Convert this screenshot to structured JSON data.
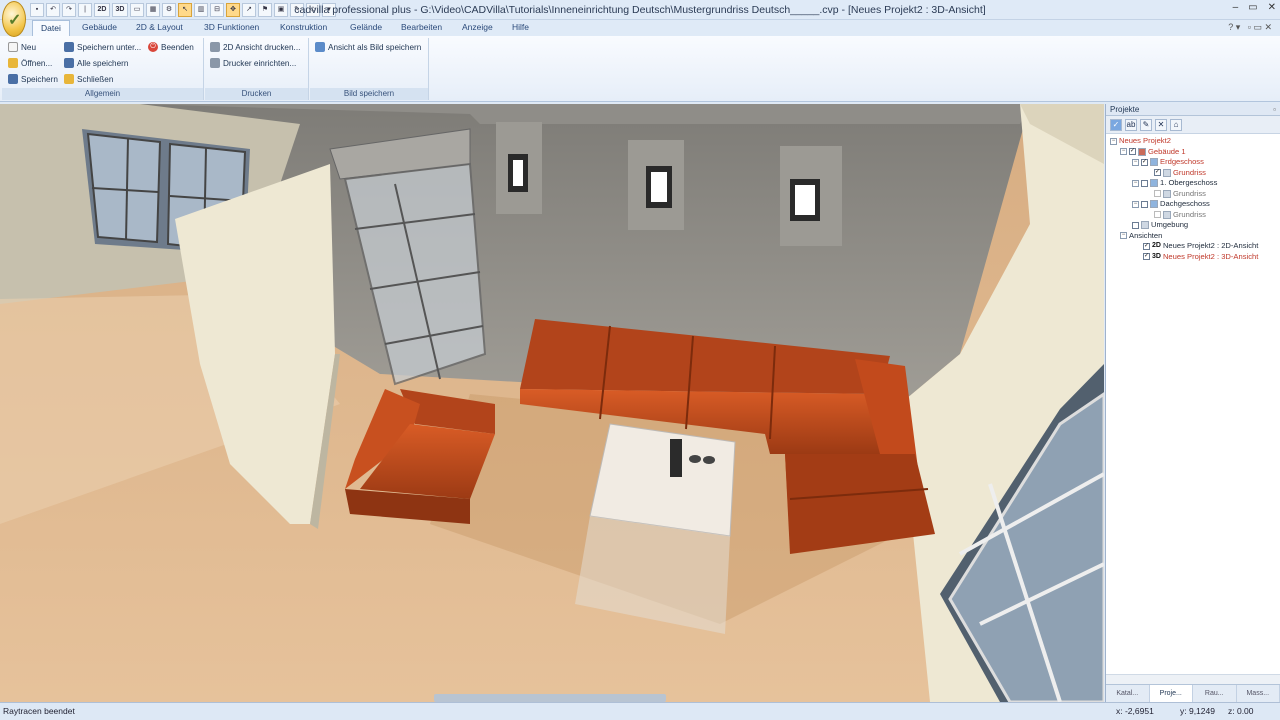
{
  "window": {
    "title": "cadvilla professional plus - G:\\Video\\CADVilla\\Tutorials\\Inneneinrichtung Deutsch\\Mustergrundriss Deutsch_____.cvp - [Neues Projekt2 : 3D-Ansicht]",
    "minimize": "–",
    "restore": "▭",
    "close": "✕"
  },
  "quick_access": {
    "btn_2d": "2D",
    "btn_3d": "3D"
  },
  "tabs": [
    "Datei",
    "Gebäude",
    "2D & Layout",
    "3D Funktionen",
    "Konstruktion",
    "Gelände",
    "Bearbeiten",
    "Anzeige",
    "Hilfe"
  ],
  "ribbon": {
    "allgemein": {
      "label": "Allgemein",
      "neu": "Neu",
      "oeffnen": "Öffnen...",
      "speichern": "Speichern",
      "speichern_unter": "Speichern unter...",
      "alle_speichern": "Alle speichern",
      "schliessen": "Schließen",
      "beenden": "Beenden"
    },
    "drucken": {
      "label": "Drucken",
      "ansicht_drucken": "2D Ansicht drucken...",
      "drucker": "Drucker einrichten..."
    },
    "bild": {
      "label": "Bild speichern",
      "ansicht_speichern": "Ansicht als Bild speichern"
    }
  },
  "panel": {
    "title": "Projekte",
    "tree": {
      "projekt": "Neues Projekt2",
      "gebaeude": "Gebäude 1",
      "erdgeschoss": "Erdgeschoss",
      "grundriss1": "Grundriss",
      "obergeschoss": "1. Obergeschoss",
      "grundriss2": "Grundriss",
      "dachgeschoss": "Dachgeschoss",
      "grundriss3": "Grundriss",
      "umgebung": "Umgebung",
      "ansichten": "Ansichten",
      "view2d_tag": "2D",
      "view2d": "Neues Projekt2 : 2D-Ansicht",
      "view3d_tag": "3D",
      "view3d": "Neues Projekt2 : 3D-Ansicht"
    },
    "bottom_tabs": [
      "Katal...",
      "Proje...",
      "Rau...",
      "Mass..."
    ]
  },
  "status": {
    "message": "Raytracen beendet",
    "x": "x: -2,6951",
    "y": "y: 9,1249",
    "z": "z: 0.00"
  },
  "colors": {
    "sofa": "#c24a1c",
    "floor": "#d9ac80",
    "wall": "#ece6d4",
    "back_wall": "#8d8b85"
  }
}
